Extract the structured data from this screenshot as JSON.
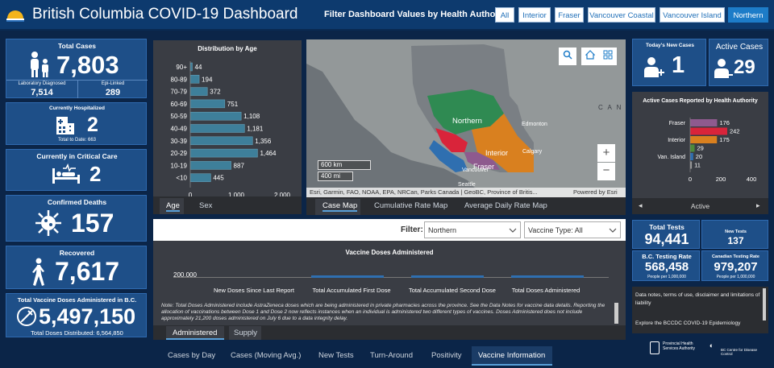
{
  "header": {
    "title": "British Columbia COVID-19 Dashboard",
    "filter_label": "Filter Dashboard Values by Health Authority:",
    "authorities": [
      "All",
      "Interior",
      "Fraser",
      "Vancouver Coastal",
      "Vancouver Island",
      "Northern"
    ],
    "active_authority": "Northern"
  },
  "total_cases": {
    "title": "Total Cases",
    "value": "7,803",
    "lab_label": "Laboratory Diagnosed",
    "lab_value": "7,514",
    "epi_label": "Epi-Linked",
    "epi_value": "289"
  },
  "hospitalized": {
    "title": "Currently Hospitalized",
    "value": "2",
    "sub": "Total to Date: 663"
  },
  "critical": {
    "title": "Currently in Critical Care",
    "value": "2"
  },
  "deaths": {
    "title": "Confirmed Deaths",
    "value": "157"
  },
  "recovered": {
    "title": "Recovered",
    "value": "7,617"
  },
  "vaccines": {
    "title": "Total Vaccine Doses Administered in B.C.",
    "value": "5,497,150",
    "sub": "Total Doses Distributed: 6,564,850"
  },
  "age_chart": {
    "title": "Distribution by Age",
    "tabs": [
      "Age",
      "Sex"
    ],
    "active_tab": "Age"
  },
  "chart_data": [
    {
      "type": "bar",
      "title": "Distribution by Age",
      "categories": [
        "90+",
        "80-89",
        "70-79",
        "60-69",
        "50-59",
        "40-49",
        "30-39",
        "20-29",
        "10-19",
        "<10"
      ],
      "values": [
        44,
        194,
        372,
        751,
        1108,
        1181,
        1356,
        1464,
        887,
        445
      ],
      "value_labels": [
        "44",
        "194",
        "372",
        "751",
        "1,108",
        "1,181",
        "1,356",
        "1,464",
        "887",
        "445"
      ],
      "xticks": [
        "0",
        "1,000",
        "2,000"
      ],
      "xlim": [
        0,
        2000
      ],
      "orientation": "horizontal"
    },
    {
      "type": "bar",
      "title": "Active Cases Reported by Health Authority",
      "categories": [
        "Fraser",
        "",
        "Interior",
        "",
        "Van. Island",
        ""
      ],
      "values": [
        176,
        242,
        175,
        29,
        20,
        11
      ],
      "value_labels": [
        "176",
        "242",
        "175",
        "29",
        "20",
        "11"
      ],
      "colors": [
        "#8e5a8e",
        "#d9243a",
        "#d9801f",
        "#4d8a3a",
        "#2f6fb0",
        "#9a9a9a"
      ],
      "xticks": [
        "0",
        "200",
        "400"
      ],
      "xlim": [
        0,
        400
      ],
      "orientation": "horizontal"
    }
  ],
  "map": {
    "labels": {
      "northern": "Northern",
      "interior": "Interior",
      "fraser": "Fraser",
      "vancouver": "Vancouver",
      "edmonton": "Edmonton",
      "calgary": "Calgary",
      "seattle": "Seattle",
      "canada": "C A N"
    },
    "scale_km": "600 km",
    "scale_mi": "400 mi",
    "attribution": "Esri, Garmin, FAO, NOAA, EPA, NRCan, Parks Canada | GeoBC, Province of Britis...",
    "powered": "Powered by Esri",
    "tabs": [
      "Case Map",
      "Cumulative Rate Map",
      "Average Daily Rate Map"
    ],
    "active_tab": "Case Map"
  },
  "vaccine_panel": {
    "filter_label": "Filter:",
    "region_select": "Northern",
    "type_select": "Vaccine Type: All",
    "chart_title": "Vaccine Doses Administered",
    "y_label": "200,000",
    "columns": [
      "New Doses Since Last Report",
      "Total Accumulated First Dose",
      "Total Accumulated Second Dose",
      "Total Doses Administered"
    ],
    "note": "Note: Total Doses Administered include AstraZeneca doses which are being administered in private pharmacies across the province. See the Data Notes for vaccine data details. Reporting the allocation of vaccinations between Dose 1 and Dose 2 now reflects instances when an individual is administered two different types of vaccines. Doses Administered does not include approximately 21,200 doses administered on July 6 due to a data integrity delay.",
    "tabs": [
      "Administered",
      "Supply"
    ],
    "active_tab": "Administered"
  },
  "bottom_tabs": {
    "items": [
      "Cases by Day",
      "Cases (Moving Avg.)",
      "New Tests",
      "Turn-Around",
      "Positivity",
      "Vaccine Information"
    ],
    "active": "Vaccine Information"
  },
  "new_cases": {
    "title": "Today's New Cases",
    "value": "1"
  },
  "active_cases": {
    "title": "Active Cases",
    "value": "29"
  },
  "active_by_ha": {
    "title": "Active Cases Reported by Health Authority",
    "footer": "Active"
  },
  "tests": {
    "total_title": "Total Tests",
    "total_value": "94,441",
    "new_title": "New Tests",
    "new_value": "137",
    "bc_rate_title": "B.C. Testing Rate",
    "bc_rate_value": "568,458",
    "bc_rate_unit": "People per 1,000,000",
    "ca_rate_title": "Canadian Testing Rate",
    "ca_rate_value": "979,207",
    "ca_rate_unit": "People per 1,000,000"
  },
  "notes": {
    "line1": "Data notes, terms of use, disclaimer and limitations of liability",
    "line2": "Explore the BCCDC COVID-19 Epidemiology",
    "logo1": "Provincial Health Services Authority",
    "logo2": "BC Centre for Disease Control"
  },
  "colors": {
    "header": "#0d3a6e",
    "card": "#1e4f88",
    "accent": "#1d7cc8",
    "panel": "#3a3d44"
  }
}
